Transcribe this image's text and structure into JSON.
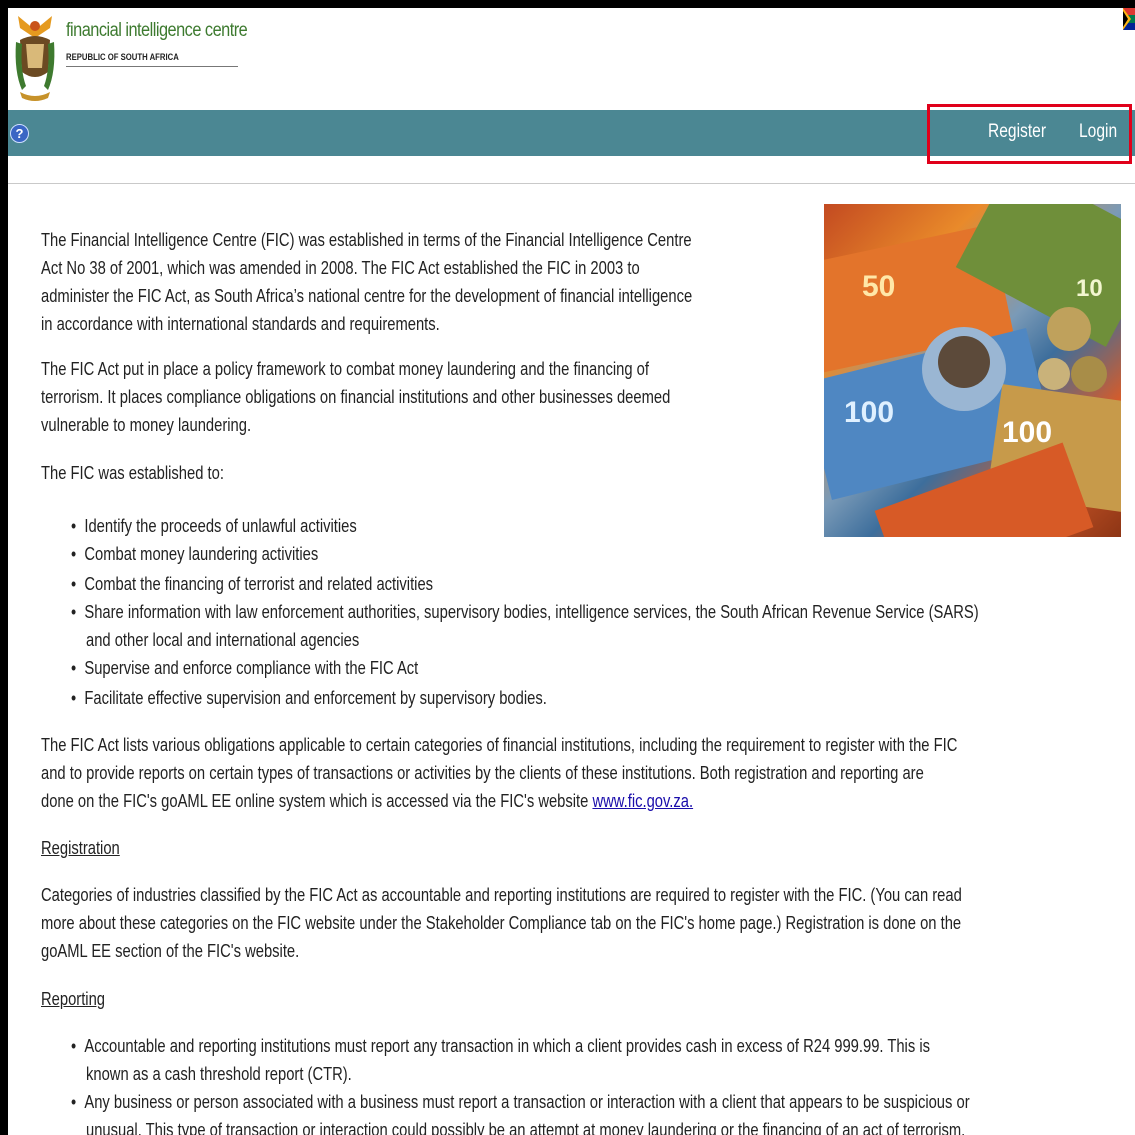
{
  "header": {
    "org_name": "financial intelligence centre",
    "org_sub": "REPUBLIC OF SOUTH AFRICA"
  },
  "nav": {
    "help_label": "?",
    "register": "Register",
    "login": "Login",
    "bar_color": "#4b8793",
    "highlight_color": "#e0001a"
  },
  "intro": {
    "p1_lines": [
      "The Financial Intelligence Centre (FIC) was established in terms of the Financial Intelligence Centre",
      "Act No 38 of 2001, which was amended in 2008. The FIC Act established the FIC in 2003 to",
      "administer the FIC Act, as South Africa’s national centre for the development of financial intelligence",
      "in accordance with international standards and requirements."
    ],
    "p2_lines": [
      "The FIC Act put in place a policy framework to combat money laundering and the financing of",
      "terrorism. It places compliance obligations on financial institutions and other businesses deemed",
      "vulnerable to money laundering."
    ],
    "p3": "The FIC was established to:"
  },
  "established_list": [
    "Identify the proceeds of unlawful activities",
    "Combat money laundering activities",
    "Combat the financing of terrorist and related activities",
    "Share information with law enforcement authorities, supervisory bodies, intelligence services, the South African Revenue Service (SARS)",
    "and other local and international agencies",
    "Supervise and enforce compliance with the FIC Act",
    "Facilitate effective supervision and enforcement by supervisory bodies."
  ],
  "obligations": {
    "lines": [
      "The FIC Act lists various obligations applicable to certain categories of financial institutions, including the requirement to register with the FIC",
      "and to provide reports on certain types of transactions or activities by the clients of these institutions. Both registration and reporting are",
      "done on the FIC's goAML EE online system which is accessed via the FIC's website "
    ],
    "link_text": "www.fic.gov.za."
  },
  "registration": {
    "heading": "Registration",
    "lines": [
      "Categories of industries classified by the FIC Act as accountable and reporting institutions are required to register with the FIC. (You can read",
      "more about these categories on the FIC website under the Stakeholder Compliance tab on the FIC's home page.) Registration is done on the",
      "goAML EE section of the FIC's website."
    ]
  },
  "reporting": {
    "heading": "Reporting",
    "items": [
      "Accountable and reporting institutions must report any transaction in which a client provides cash in excess of R24 999.99. This is",
      "known as a cash threshold report (CTR).",
      "Any business or person associated with a business must report a transaction or interaction with a client that appears to be suspicious or",
      "unusual. This type of transaction or interaction could possibly be an attempt at money laundering or the financing of an act of terrorism."
    ]
  },
  "image": {
    "notes": [
      "50",
      "100",
      "100",
      "10"
    ]
  }
}
